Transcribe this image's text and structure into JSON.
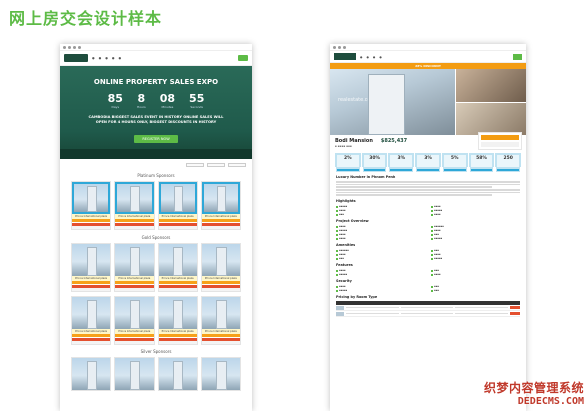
{
  "page": {
    "title": "网上房交会设计样本"
  },
  "left": {
    "hero_title": "ONLINE PROPERTY SALES EXPO",
    "countdown": [
      {
        "num": "85",
        "unit": "Days"
      },
      {
        "num": "8",
        "unit": "Hours"
      },
      {
        "num": "08",
        "unit": "Minutes"
      },
      {
        "num": "55",
        "unit": "Seconds"
      }
    ],
    "tagline": "CAMBODIA BIGGEST SALES EVENT IN HISTORY ONLINE SALES WILL OPEN FOR 4 HOURS ONLY, BIGGEST DISCOUNTS IN HISTORY",
    "cta": "REGISTER NOW",
    "sections": [
      "Platinum Sponsors",
      "Gold Sponsors",
      "Silver Sponsors"
    ],
    "card_title": "Prince International plaza"
  },
  "right": {
    "banner": "28% DISCOUNT",
    "watermark": "realestate.com.kh",
    "name": "Bodi Mansion",
    "price": "$825,437",
    "discounts": [
      "2%",
      "30%",
      "3%",
      "3%",
      "5%",
      "58%",
      "250"
    ],
    "headings": [
      "Luxury Number in Phnom Penh",
      "Highlights",
      "Project Overview",
      "Amenities",
      "Features",
      "Security",
      "Pricing by Room Type"
    ]
  },
  "watermark": {
    "line1": "织梦内容管理系统",
    "line2": "DEDECMS.COM"
  }
}
